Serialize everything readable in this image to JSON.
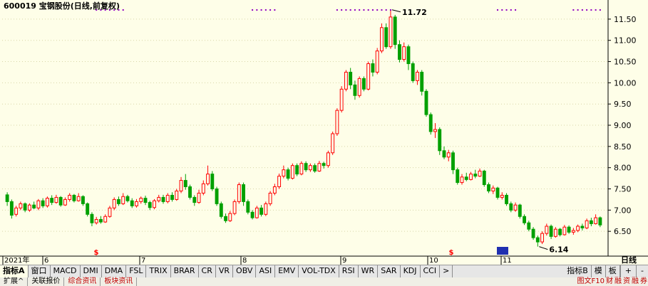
{
  "title": "600019 宝钢股份(日线,前复权)",
  "max_label": "11.72",
  "min_label": "6.14",
  "period_label": "日线",
  "date_axis": [
    "2021年",
    "6",
    "7",
    "8",
    "9",
    "10",
    "11"
  ],
  "chart_data": {
    "type": "candlestick",
    "title": "600019 宝钢股份(日线,前复权)",
    "ylim": [
      6.05,
      11.85
    ],
    "yticks": [
      "11.50",
      "11.00",
      "10.50",
      "10.00",
      "9.50",
      "9.00",
      "8.50",
      "8.00",
      "7.50",
      "7.00",
      "6.50"
    ],
    "months": [
      "6",
      "7",
      "8",
      "9",
      "10",
      "11"
    ],
    "annotations": {
      "high": 11.72,
      "low": 6.14
    },
    "candles": [
      [
        7.36,
        7.2,
        7.42,
        7.1
      ],
      [
        7.2,
        6.88,
        7.25,
        6.8
      ],
      [
        6.9,
        7.05,
        7.1,
        6.85
      ],
      [
        7.05,
        7.15,
        7.2,
        7.0
      ],
      [
        7.15,
        7.0,
        7.18,
        6.95
      ],
      [
        7.0,
        7.12,
        7.16,
        6.96
      ],
      [
        7.12,
        7.05,
        7.2,
        7.02
      ],
      [
        7.05,
        7.22,
        7.26,
        7.0
      ],
      [
        7.22,
        7.1,
        7.28,
        7.05
      ],
      [
        7.1,
        7.28,
        7.32,
        7.06
      ],
      [
        7.28,
        7.18,
        7.35,
        7.12
      ],
      [
        7.18,
        7.3,
        7.36,
        7.15
      ],
      [
        7.3,
        7.12,
        7.33,
        7.08
      ],
      [
        7.12,
        7.25,
        7.3,
        7.1
      ],
      [
        7.25,
        7.35,
        7.4,
        7.2
      ],
      [
        7.35,
        7.22,
        7.38,
        7.18
      ],
      [
        7.22,
        7.32,
        7.4,
        7.2
      ],
      [
        7.32,
        7.15,
        7.35,
        7.1
      ],
      [
        7.15,
        6.9,
        7.18,
        6.85
      ],
      [
        6.9,
        6.7,
        6.95,
        6.62
      ],
      [
        6.7,
        6.78,
        6.84,
        6.66
      ],
      [
        6.78,
        6.72,
        6.86,
        6.68
      ],
      [
        6.72,
        6.85,
        6.9,
        6.7
      ],
      [
        6.85,
        7.05,
        7.1,
        6.82
      ],
      [
        7.05,
        7.25,
        7.3,
        7.0
      ],
      [
        7.25,
        7.15,
        7.32,
        7.1
      ],
      [
        7.15,
        7.32,
        7.4,
        7.12
      ],
      [
        7.32,
        7.22,
        7.36,
        7.18
      ],
      [
        7.22,
        7.1,
        7.28,
        7.05
      ],
      [
        7.1,
        7.2,
        7.26,
        7.06
      ],
      [
        7.2,
        7.28,
        7.32,
        7.15
      ],
      [
        7.28,
        7.18,
        7.34,
        7.12
      ],
      [
        7.18,
        7.06,
        7.22,
        7.0
      ],
      [
        7.06,
        7.22,
        7.26,
        7.02
      ],
      [
        7.22,
        7.3,
        7.36,
        7.18
      ],
      [
        7.3,
        7.2,
        7.36,
        7.15
      ],
      [
        7.2,
        7.35,
        7.4,
        7.16
      ],
      [
        7.35,
        7.25,
        7.42,
        7.2
      ],
      [
        7.25,
        7.45,
        7.5,
        7.22
      ],
      [
        7.45,
        7.7,
        7.78,
        7.4
      ],
      [
        7.7,
        7.55,
        7.85,
        7.48
      ],
      [
        7.55,
        7.3,
        7.6,
        7.25
      ],
      [
        7.3,
        7.18,
        7.35,
        7.1
      ],
      [
        7.18,
        7.4,
        7.48,
        7.15
      ],
      [
        7.4,
        7.62,
        7.7,
        7.35
      ],
      [
        7.62,
        7.85,
        8.05,
        7.58
      ],
      [
        7.85,
        7.5,
        7.92,
        7.45
      ],
      [
        7.5,
        7.15,
        7.55,
        7.1
      ],
      [
        7.15,
        6.85,
        7.2,
        6.8
      ],
      [
        6.85,
        6.75,
        6.92,
        6.7
      ],
      [
        6.75,
        6.92,
        6.98,
        6.72
      ],
      [
        6.92,
        7.2,
        7.25,
        6.88
      ],
      [
        7.2,
        7.6,
        7.65,
        7.15
      ],
      [
        7.6,
        7.2,
        7.65,
        7.1
      ],
      [
        7.2,
        6.95,
        7.25,
        6.9
      ],
      [
        6.95,
        6.82,
        7.0,
        6.78
      ],
      [
        6.82,
        7.05,
        7.1,
        6.8
      ],
      [
        7.05,
        6.9,
        7.12,
        6.85
      ],
      [
        6.9,
        7.15,
        7.2,
        6.86
      ],
      [
        7.15,
        7.4,
        7.45,
        7.1
      ],
      [
        7.4,
        7.55,
        7.62,
        7.35
      ],
      [
        7.55,
        7.8,
        7.86,
        7.5
      ],
      [
        7.8,
        7.95,
        8.05,
        7.75
      ],
      [
        7.95,
        7.75,
        8.0,
        7.7
      ],
      [
        7.75,
        8.05,
        8.1,
        7.72
      ],
      [
        8.05,
        7.85,
        8.1,
        7.8
      ],
      [
        7.85,
        8.1,
        8.15,
        7.82
      ],
      [
        8.1,
        7.95,
        8.15,
        7.9
      ],
      [
        7.95,
        8.05,
        8.1,
        7.9
      ],
      [
        8.05,
        7.92,
        8.1,
        7.88
      ],
      [
        7.92,
        8.1,
        8.16,
        7.9
      ],
      [
        8.1,
        8.05,
        8.14,
        7.98
      ],
      [
        8.05,
        8.35,
        8.4,
        8.0
      ],
      [
        8.35,
        8.8,
        8.85,
        8.3
      ],
      [
        8.8,
        9.35,
        9.4,
        8.75
      ],
      [
        9.35,
        9.85,
        9.92,
        9.3
      ],
      [
        9.85,
        10.25,
        10.3,
        9.8
      ],
      [
        10.25,
        9.95,
        10.35,
        9.85
      ],
      [
        9.95,
        9.7,
        10.05,
        9.6
      ],
      [
        9.7,
        10.1,
        10.15,
        9.65
      ],
      [
        10.1,
        9.85,
        10.15,
        9.8
      ],
      [
        9.85,
        10.45,
        10.5,
        9.82
      ],
      [
        10.45,
        10.25,
        10.55,
        10.15
      ],
      [
        10.25,
        10.75,
        10.82,
        10.2
      ],
      [
        10.75,
        11.3,
        11.4,
        10.7
      ],
      [
        11.3,
        10.85,
        11.4,
        10.8
      ],
      [
        10.85,
        11.55,
        11.72,
        10.8
      ],
      [
        11.55,
        10.9,
        11.6,
        10.8
      ],
      [
        10.9,
        10.55,
        11.0,
        10.48
      ],
      [
        10.55,
        10.85,
        10.95,
        10.5
      ],
      [
        10.85,
        10.45,
        10.9,
        10.3
      ],
      [
        10.45,
        10.05,
        10.5,
        10.0
      ],
      [
        10.05,
        10.25,
        10.3,
        9.95
      ],
      [
        10.25,
        9.8,
        10.3,
        9.7
      ],
      [
        9.8,
        9.25,
        9.85,
        9.2
      ],
      [
        9.25,
        8.85,
        9.3,
        8.78
      ],
      [
        8.85,
        8.9,
        9.05,
        8.7
      ],
      [
        8.9,
        8.4,
        8.95,
        8.3
      ],
      [
        8.4,
        8.25,
        8.5,
        8.2
      ],
      [
        8.25,
        8.35,
        8.42,
        8.15
      ],
      [
        8.35,
        7.95,
        8.4,
        7.85
      ],
      [
        7.95,
        7.65,
        8.0,
        7.6
      ],
      [
        7.65,
        7.78,
        7.85,
        7.6
      ],
      [
        7.78,
        7.72,
        7.88,
        7.68
      ],
      [
        7.72,
        7.85,
        7.9,
        7.7
      ],
      [
        7.85,
        7.8,
        7.95,
        7.75
      ],
      [
        7.8,
        7.92,
        7.98,
        7.78
      ],
      [
        7.92,
        7.6,
        7.95,
        7.55
      ],
      [
        7.6,
        7.45,
        7.65,
        7.4
      ],
      [
        7.45,
        7.52,
        7.58,
        7.38
      ],
      [
        7.52,
        7.3,
        7.55,
        7.25
      ],
      [
        7.3,
        7.35,
        7.42,
        7.25
      ],
      [
        7.35,
        7.15,
        7.4,
        7.1
      ],
      [
        7.15,
        7.0,
        7.2,
        6.95
      ],
      [
        7.0,
        7.12,
        7.18,
        6.96
      ],
      [
        7.12,
        6.85,
        7.15,
        6.8
      ],
      [
        6.85,
        6.7,
        6.9,
        6.65
      ],
      [
        6.7,
        6.55,
        6.75,
        6.5
      ],
      [
        6.55,
        6.35,
        6.6,
        6.3
      ],
      [
        6.35,
        6.25,
        6.4,
        6.14
      ],
      [
        6.25,
        6.45,
        6.5,
        6.2
      ],
      [
        6.45,
        6.62,
        6.68,
        6.4
      ],
      [
        6.62,
        6.38,
        6.66,
        6.32
      ],
      [
        6.38,
        6.55,
        6.6,
        6.35
      ],
      [
        6.55,
        6.42,
        6.58,
        6.38
      ],
      [
        6.42,
        6.6,
        6.65,
        6.4
      ],
      [
        6.6,
        6.48,
        6.64,
        6.44
      ],
      [
        6.48,
        6.52,
        6.58,
        6.42
      ],
      [
        6.52,
        6.62,
        6.66,
        6.48
      ],
      [
        6.62,
        6.58,
        6.68,
        6.52
      ],
      [
        6.58,
        6.75,
        6.8,
        6.55
      ],
      [
        6.75,
        6.68,
        6.82,
        6.62
      ],
      [
        6.68,
        6.82,
        6.9,
        6.66
      ],
      [
        6.82,
        6.65,
        6.85,
        6.6
      ]
    ]
  },
  "indicator_tabs": [
    "指标A",
    "窗口",
    "MACD",
    "DMI",
    "DMA",
    "FSL",
    "TRIX",
    "BRAR",
    "CR",
    "VR",
    "OBV",
    "ASI",
    "EMV",
    "VOL-TDX",
    "RSI",
    "WR",
    "SAR",
    "KDJ",
    "CCI",
    ">"
  ],
  "right_tabs": [
    "指标B",
    "模",
    "板"
  ],
  "zoom_buttons": [
    "+",
    "-"
  ],
  "sub_tabs": [
    {
      "label": "扩展^",
      "red": false
    },
    {
      "label": "关联报价",
      "red": false
    },
    {
      "label": "综合资讯",
      "red": true
    },
    {
      "label": "板块资讯",
      "red": true
    }
  ],
  "bottom_right": [
    "图文F10",
    "财",
    "融",
    "资",
    "融",
    "券"
  ],
  "colors": {
    "up": "#ff0000",
    "down": "#00a000",
    "bg": "#fefee8",
    "axis": "#000000",
    "text": "#000000",
    "accent": "#0000c0"
  }
}
